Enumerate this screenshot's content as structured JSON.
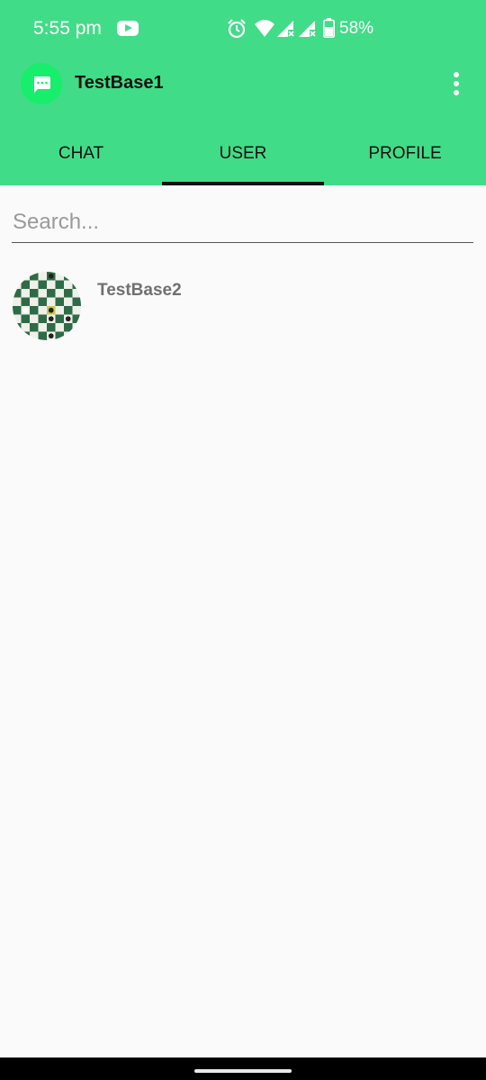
{
  "status_bar": {
    "time": "5:55 pm",
    "battery": "58%",
    "icons": [
      "youtube-icon",
      "alarm-icon",
      "wifi-icon",
      "signal-icon",
      "signal-icon",
      "battery-icon"
    ]
  },
  "app_bar": {
    "title": "TestBase1",
    "logo_icon": "chat-bubble-icon",
    "menu_icon": "more-vert-icon",
    "accent_color": "#41dc87"
  },
  "tabs": [
    {
      "label": "CHAT",
      "selected": false
    },
    {
      "label": "USER",
      "selected": true
    },
    {
      "label": "PROFILE",
      "selected": false
    }
  ],
  "search": {
    "placeholder": "Search...",
    "value": ""
  },
  "users": [
    {
      "name": "TestBase2",
      "avatar": "chessboard-avatar"
    }
  ]
}
